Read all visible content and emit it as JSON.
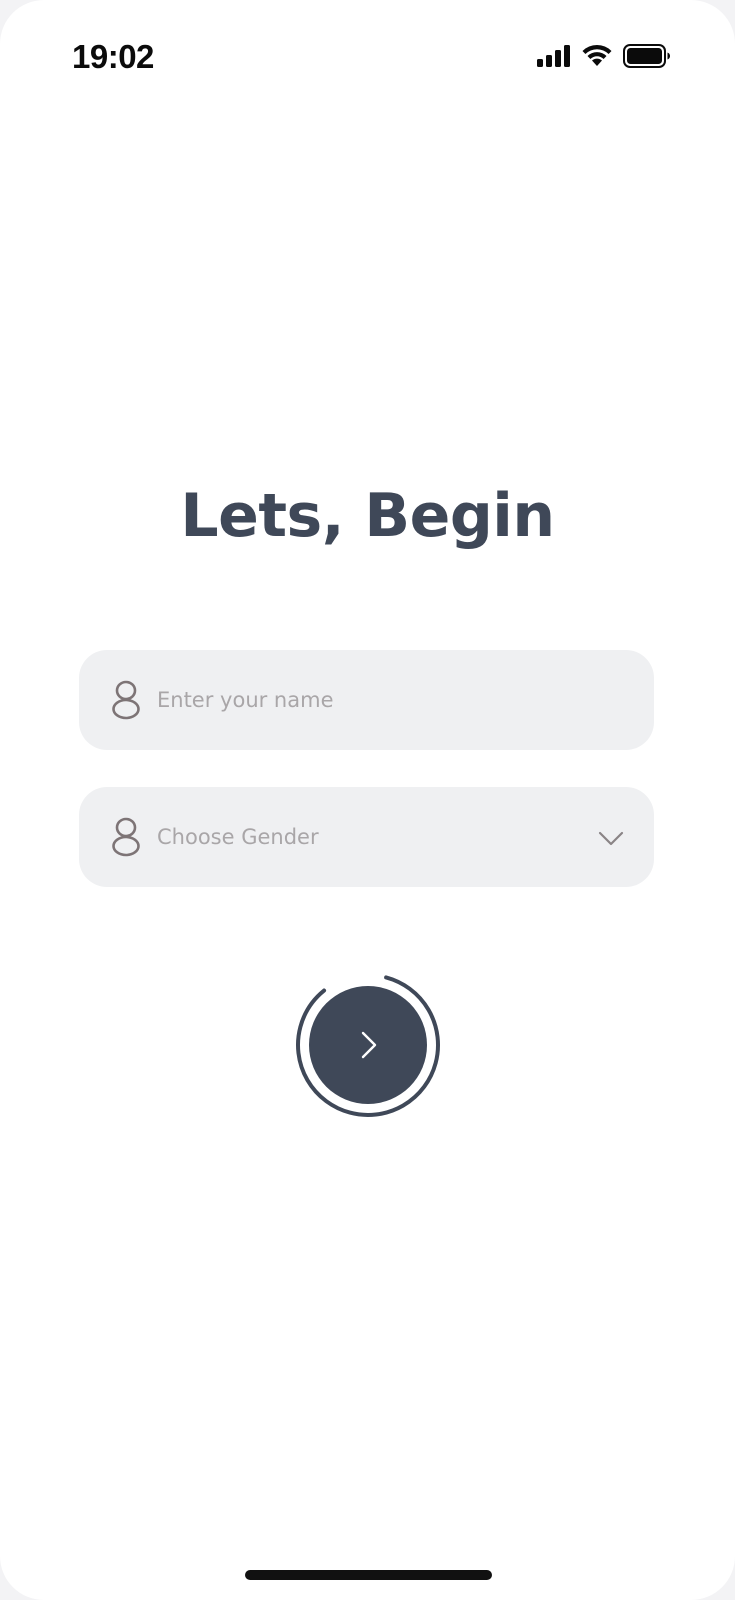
{
  "status_bar": {
    "time": "19:02",
    "icons": [
      "cellular-signal-icon",
      "wifi-icon",
      "battery-icon"
    ]
  },
  "main": {
    "title": "Lets, Begin",
    "name_field": {
      "placeholder": "Enter your name",
      "value": "",
      "icon": "user-icon"
    },
    "gender_select": {
      "placeholder": "Choose Gender",
      "icon": "user-icon",
      "dropdown_icon": "chevron-down-icon"
    },
    "next_button": {
      "icon": "chevron-right-icon",
      "progress": 0.85
    }
  },
  "colors": {
    "accent": "#3f4858",
    "field_background": "#eff0f2",
    "placeholder_text": "#a9a6a8",
    "icon_color": "#7d7476"
  }
}
